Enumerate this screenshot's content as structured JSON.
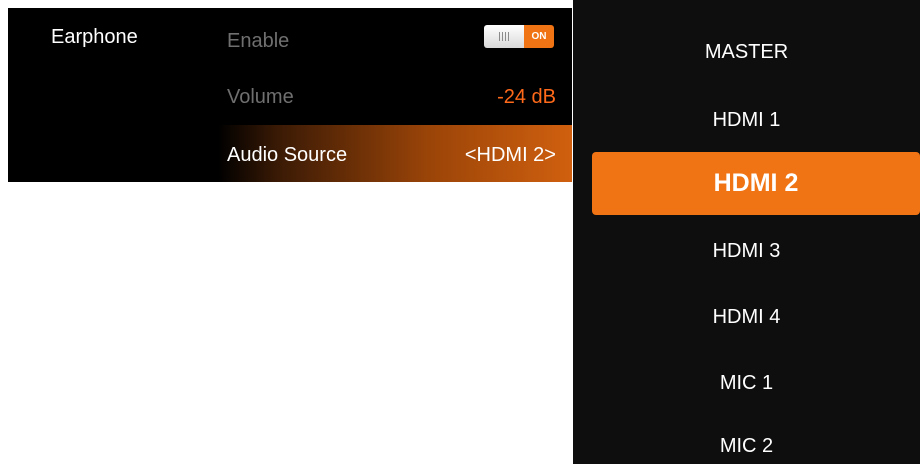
{
  "earphone": {
    "section_label": "Earphone",
    "enable": {
      "label": "Enable",
      "toggle_state": "ON",
      "enabled": true
    },
    "volume": {
      "label": "Volume",
      "value": "-24 dB"
    },
    "audio_source": {
      "label": "Audio Source",
      "value": "<HDMI 2>"
    }
  },
  "source_list": {
    "items": [
      "MASTER",
      "HDMI 1",
      "HDMI 2",
      "HDMI 3",
      "HDMI 4",
      "MIC 1",
      "MIC 2"
    ],
    "selected": "HDMI 2"
  },
  "colors": {
    "accent": "#f07414",
    "value_orange": "#ff6a1a",
    "panel_bg": "#000000",
    "dimmed_label": "#6f6f6f"
  }
}
